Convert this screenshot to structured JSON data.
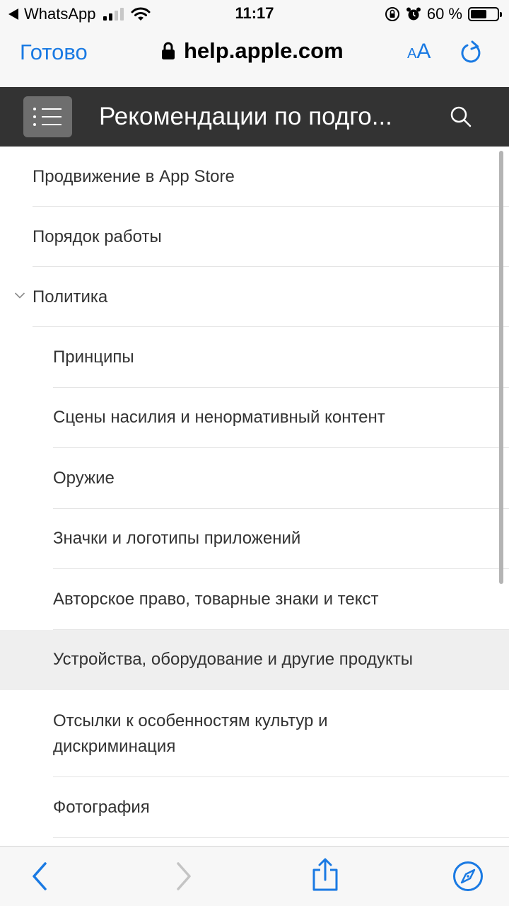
{
  "status_bar": {
    "back_app": "WhatsApp",
    "time": "11:17",
    "battery_percent": "60 %",
    "battery_level": 0.6,
    "signal_bars_total": 4,
    "signal_bars_active": 2
  },
  "browser": {
    "done_label": "Готово",
    "url": "help.apple.com",
    "text_size_small": "A",
    "text_size_big": "A",
    "accent_color": "#1a7ae3"
  },
  "header": {
    "title": "Рекомендации по подго...",
    "background_color": "#333333"
  },
  "nav": {
    "items": [
      {
        "label": "Продвижение в App Store",
        "level": 0
      },
      {
        "label": "Порядок работы",
        "level": 0
      },
      {
        "label": "Политика",
        "level": 0,
        "expanded": true
      },
      {
        "label": "Принципы",
        "level": 1
      },
      {
        "label": "Сцены насилия и ненормативный контент",
        "level": 1
      },
      {
        "label": "Оружие",
        "level": 1
      },
      {
        "label": "Значки и логотипы приложений",
        "level": 1
      },
      {
        "label": "Авторское право, товарные знаки и текст",
        "level": 1
      },
      {
        "label": "Устройства, оборудование и другие продукты",
        "level": 1,
        "highlighted": true
      },
      {
        "label": "Отсылки к особенностям культур и дискриминация",
        "level": 1
      },
      {
        "label": "Фотография",
        "level": 1
      }
    ]
  },
  "toolbar": {
    "icons": [
      "back-icon",
      "forward-icon",
      "share-icon",
      "compass-icon"
    ]
  }
}
